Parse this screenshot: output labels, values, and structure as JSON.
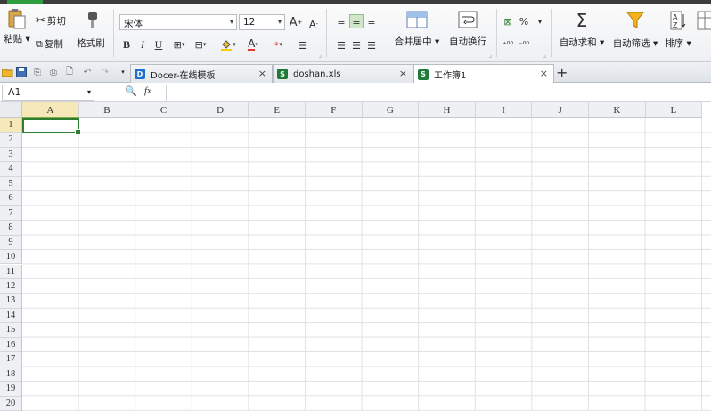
{
  "ribbon": {
    "clipboard": {
      "paste_label": "粘贴",
      "cut_label": "剪切",
      "copy_label": "复制",
      "format_painter_label": "格式刷"
    },
    "font": {
      "font_name": "宋体",
      "font_size": "12",
      "grow_label": "A",
      "shrink_label": "A",
      "bold_label": "B",
      "italic_label": "I",
      "underline_label": "U",
      "font_color_label": "A"
    },
    "alignment": {
      "merge_center_label": "合并居中",
      "wrap_text_label": "自动换行"
    },
    "number": {
      "percent_label": "%"
    },
    "editing": {
      "autosum_label": "自动求和",
      "autofilter_label": "自动筛选",
      "sort_label": "排序",
      "sigma_glyph": "Σ"
    }
  },
  "tabs": [
    {
      "label": "Docer-在线模板",
      "icon": "docer-icon",
      "active": false
    },
    {
      "label": "doshan.xls",
      "icon": "spreadsheet-icon",
      "active": false
    },
    {
      "label": "工作簿1",
      "icon": "spreadsheet-icon",
      "active": true
    }
  ],
  "formula_bar": {
    "name_box": "A1",
    "fx_label": "fx",
    "formula_value": ""
  },
  "grid": {
    "columns": [
      "A",
      "B",
      "C",
      "D",
      "E",
      "F",
      "G",
      "H",
      "I",
      "J",
      "K",
      "L"
    ],
    "rows": [
      "1",
      "2",
      "3",
      "4",
      "5",
      "6",
      "7",
      "8",
      "9",
      "10",
      "11",
      "12",
      "13",
      "14",
      "15",
      "16",
      "17",
      "18",
      "19",
      "20"
    ],
    "selected_cell": "A1"
  },
  "colors": {
    "accent_green": "#2e7d32",
    "header_selected": "#f6e8b8"
  }
}
